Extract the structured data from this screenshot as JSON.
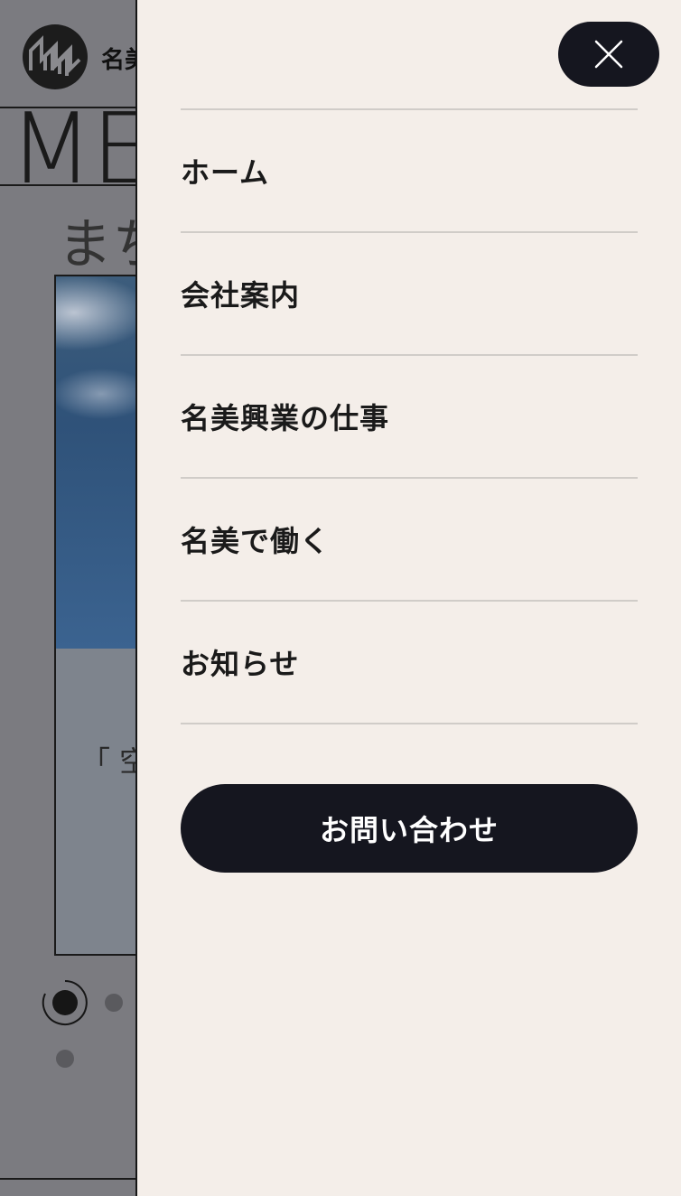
{
  "background_page": {
    "company_name": "名美",
    "hero_text": "ME",
    "heading_jp": "まち",
    "card_caption": "「 空"
  },
  "drawer": {
    "close_icon": "close-icon",
    "menu_items": [
      {
        "label": "ホーム"
      },
      {
        "label": "会社案内"
      },
      {
        "label": "名美興業の仕事"
      },
      {
        "label": "名美で働く"
      },
      {
        "label": "お知らせ"
      }
    ],
    "contact_label": "お問い合わせ"
  },
  "colors": {
    "drawer_bg": "#f4eee9",
    "dark": "#15161f",
    "overlay": "#7b7b80",
    "divider": "#d0ccc8"
  }
}
